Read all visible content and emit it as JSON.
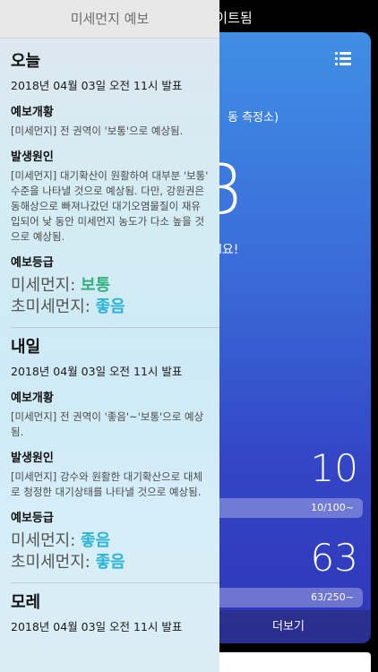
{
  "background": {
    "title_fragment": "이트됨",
    "station_fragment": "동 측정소)",
    "big_glyph": "3",
    "message_fragment": "l요!",
    "pm10": {
      "value": "10",
      "bar_label": "10/100~"
    },
    "pm25": {
      "value": "63",
      "bar_label": "63/250~"
    },
    "more_button": "더보기"
  },
  "drawer": {
    "header": "미세먼지 예보",
    "sections": [
      {
        "title": "오늘",
        "date": "2018년 04월 03일 오전 11시 발표",
        "overview_label": "예보개황",
        "overview_text": "[미세먼지] 전 권역이 '보통'으로 예상됨.",
        "cause_label": "발생원인",
        "cause_text": "[미세먼지] 대기확산이 원활하여 대부분 '보통' 수준을 나타낼 것으로 예상됨. 다만, 강원권은 동해상으로 빠져나갔던 대기오염물질이 재유입되어 낮 동안 미세먼지 농도가 다소 높을 것으로 예상됨.",
        "grade_label": "예보등급",
        "pm10_label": "미세먼지:",
        "pm10_grade": "보통",
        "pm25_label": "초미세먼지:",
        "pm25_grade": "좋음"
      },
      {
        "title": "내일",
        "date": "2018년 04월 03일 오전 11시 발표",
        "overview_label": "예보개황",
        "overview_text": "[미세먼지] 전 권역이 '좋음'~'보통'으로 예상됨.",
        "cause_label": "발생원인",
        "cause_text": "[미세먼지] 강수와 원활한 대기확산으로 대체로 청정한 대기상태를 나타낼 것으로 예상됨.",
        "grade_label": "예보등급",
        "pm10_label": "미세먼지:",
        "pm10_grade": "좋음",
        "pm25_label": "초미세먼지:",
        "pm25_grade": "좋음"
      },
      {
        "title": "모레",
        "date": "2018년 04월 03일 오전 11시 발표"
      }
    ]
  },
  "colors": {
    "grade_normal": "#33b07e",
    "grade_good": "#2bb4d6"
  }
}
